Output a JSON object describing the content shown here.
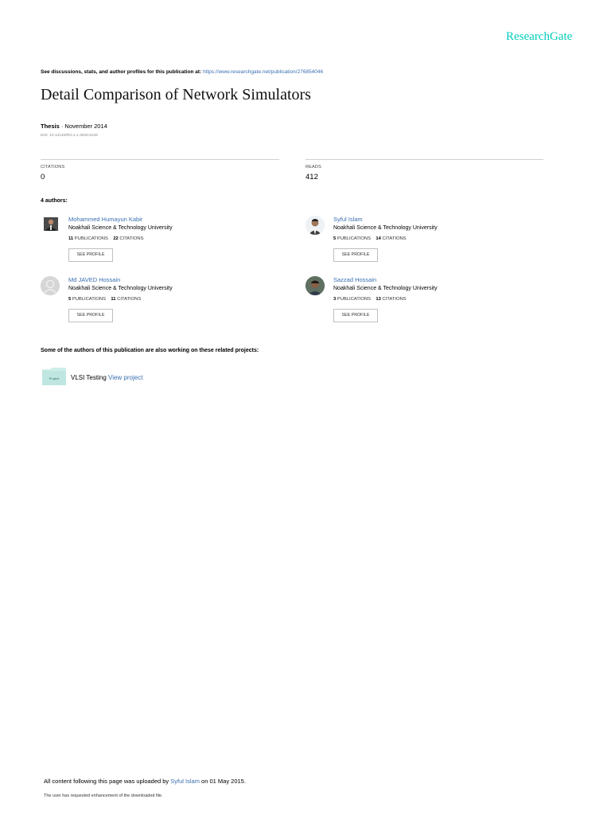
{
  "brand": "ResearchGate",
  "top_line": {
    "prefix": "See discussions, stats, and author profiles for this publication at:",
    "url": "https://www.researchgate.net/publication/276854046"
  },
  "title": "Detail Comparison of Network Simulators",
  "meta": {
    "type": "Thesis",
    "date": " · November 2014"
  },
  "doi": "DOI: 10.13140/RG.2.1.3040.9128",
  "stats": {
    "citations_label": "CITATIONS",
    "citations_value": "0",
    "reads_label": "READS",
    "reads_value": "412"
  },
  "authors_heading": "4 authors:",
  "authors": [
    {
      "name": "Mohammed Humayun Kabir",
      "institution": "Noakhali Science & Technology University",
      "publications": "11",
      "publications_label": "PUBLICATIONS",
      "citations": "22",
      "citations_label": "CITATIONS",
      "button": "SEE PROFILE"
    },
    {
      "name": "Syful Islam",
      "institution": "Noakhali Science & Technology University",
      "publications": "5",
      "publications_label": "PUBLICATIONS",
      "citations": "14",
      "citations_label": "CITATIONS",
      "button": "SEE PROFILE"
    },
    {
      "name": "Md JAVED Hossain",
      "institution": "Noakhali Science & Technology University",
      "publications": "5",
      "publications_label": "PUBLICATIONS",
      "citations": "11",
      "citations_label": "CITATIONS",
      "button": "SEE PROFILE"
    },
    {
      "name": "Sazzad Hossain",
      "institution": "Noakhali Science & Technology University",
      "publications": "3",
      "publications_label": "PUBLICATIONS",
      "citations": "13",
      "citations_label": "CITATIONS",
      "button": "SEE PROFILE"
    }
  ],
  "related_heading": "Some of the authors of this publication are also working on these related projects:",
  "project": {
    "thumb_label": "Project",
    "name": "VLSI Testing",
    "link": "View project"
  },
  "footer": {
    "prefix": "All content following this page was uploaded by ",
    "uploader": "Syful Islam",
    "suffix": " on 01 May 2015.",
    "note": "The user has requested enhancement of the downloaded file."
  }
}
